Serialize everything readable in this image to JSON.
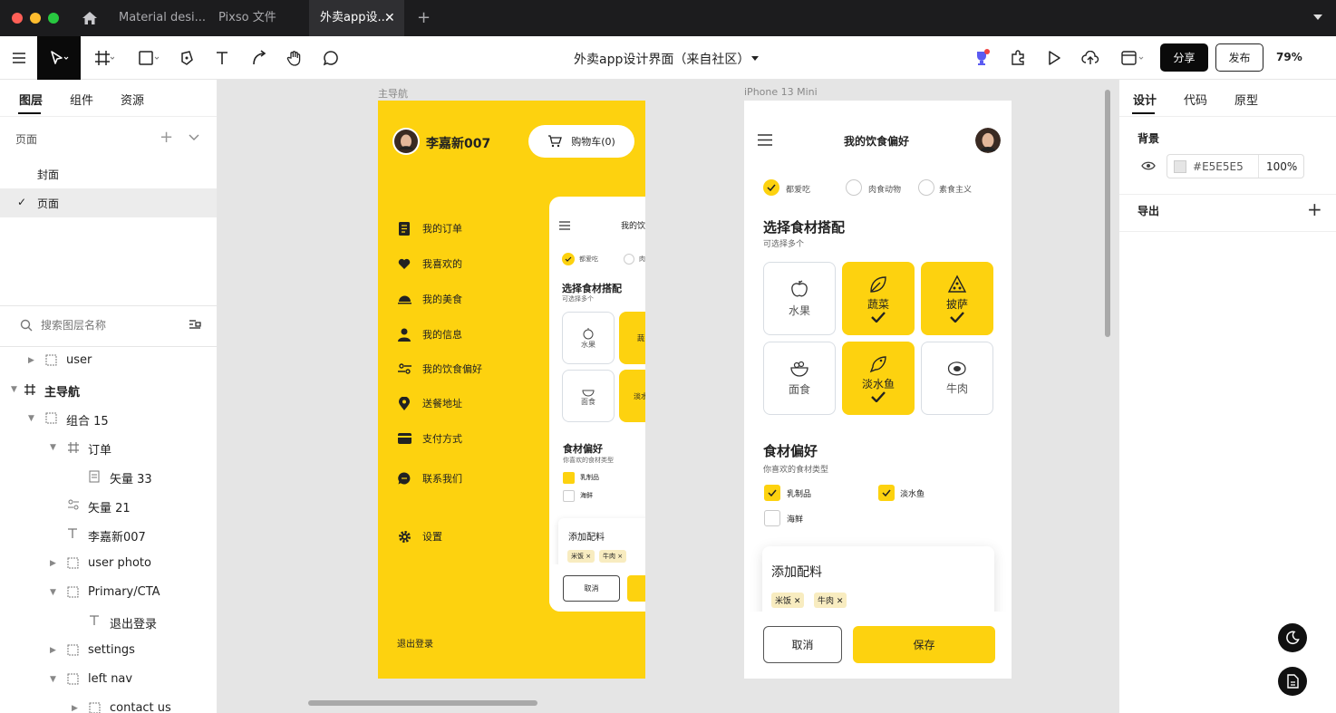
{
  "window": {
    "tabs": [
      {
        "label": "Material desi..."
      },
      {
        "label": "Pixso 文件"
      },
      {
        "label": "外卖app设...",
        "active": true
      }
    ]
  },
  "toolbar": {
    "doc_title": "外卖app设计界面（来自社区）",
    "share_label": "分享",
    "publish_label": "发布",
    "zoom": "79%"
  },
  "left": {
    "tabs": [
      "图层",
      "组件",
      "资源"
    ],
    "pages_header": "页面",
    "pages": [
      {
        "label": "封面"
      },
      {
        "label": "页面",
        "selected": true
      }
    ],
    "search_placeholder": "搜索图层名称",
    "layers": [
      {
        "label": "user"
      },
      {
        "label": "主导航"
      },
      {
        "label": "组合 15"
      },
      {
        "label": "订单"
      },
      {
        "label": "矢量 33"
      },
      {
        "label": "矢量 21"
      },
      {
        "label": "李嘉新007"
      },
      {
        "label": "user photo"
      },
      {
        "label": "Primary/CTA"
      },
      {
        "label": "退出登录"
      },
      {
        "label": "settings"
      },
      {
        "label": "left nav"
      },
      {
        "label": "contact us"
      }
    ]
  },
  "canvas": {
    "frame1_label": "主导航",
    "frame2_label": "iPhone 13 Mini",
    "nav": {
      "user_name": "李嘉新007",
      "cart_label": "购物车(0)",
      "items": [
        "我的订单",
        "我喜欢的",
        "我的美食",
        "我的信息",
        "我的饮食偏好",
        "送餐地址",
        "支付方式",
        "联系我们",
        "设置"
      ],
      "logout": "退出登录"
    },
    "mini": {
      "title": "我的饮",
      "opt1": "都爱吃",
      "opt2": "肉",
      "section1": "选择食材搭配",
      "section1_sub": "可选择多个",
      "card1": "水果",
      "card2": "蔬",
      "card3": "面食",
      "card4": "淡水",
      "section2": "食材偏好",
      "section2_sub": "你喜欢的食材类型",
      "pref1": "乳制品",
      "pref2": "海鲜",
      "add_title": "添加配料",
      "tag1": "米饭",
      "tag2": "牛肉",
      "cancel": "取消"
    },
    "phone": {
      "title": "我的饮食偏好",
      "options": [
        "都爱吃",
        "肉食动物",
        "素食主义"
      ],
      "section1": "选择食材搭配",
      "section1_sub": "可选择多个",
      "cards": [
        "水果",
        "蔬菜",
        "披萨",
        "面食",
        "淡水鱼",
        "牛肉"
      ],
      "section2": "食材偏好",
      "section2_sub": "你喜欢的食材类型",
      "prefs": [
        "乳制品",
        "淡水鱼",
        "海鲜"
      ],
      "add_title": "添加配料",
      "tags": [
        "米饭",
        "牛肉"
      ],
      "cancel": "取消",
      "save": "保存"
    }
  },
  "right": {
    "tabs": [
      "设计",
      "代码",
      "原型"
    ],
    "background_label": "背景",
    "bg_hex": "E5E5E5",
    "bg_opacity": "100",
    "export_label": "导出"
  },
  "colors": {
    "accent": "#FDD20F",
    "canvas": "#E5E5E5",
    "dark": "#1C1C1E"
  }
}
